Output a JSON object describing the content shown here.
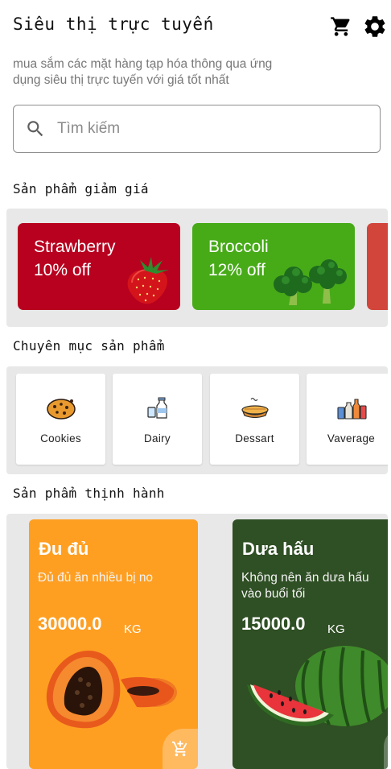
{
  "app": {
    "title": "Siêu thị trực tuyến",
    "subtitle": "mua sắm các mặt hàng tạp hóa thông qua ứng dụng siêu thị trực tuyến với giá tốt nhất",
    "cart_icon": "shopping-cart-icon",
    "settings_icon": "gear-icon"
  },
  "search": {
    "placeholder": "Tìm kiếm",
    "value": "",
    "icon": "search-icon"
  },
  "sections": {
    "discount": "Sản phẩm giảm giá",
    "categories": "Chuyên mục sản phẩm",
    "trending": "Sản phẩm thịnh hành"
  },
  "discount_products": [
    {
      "name": "Strawberry",
      "discount": "10% off",
      "color": "#b8001f"
    },
    {
      "name": "Broccoli",
      "discount": "12% off",
      "color": "#47ab18"
    }
  ],
  "categories": [
    {
      "label": "Cookies",
      "icon": "cookie-icon"
    },
    {
      "label": "Dairy",
      "icon": "milk-bottle-icon"
    },
    {
      "label": "Dessart",
      "icon": "pie-icon"
    },
    {
      "label": "Vaverage",
      "icon": "beverage-bottles-icon"
    }
  ],
  "trending_products": [
    {
      "name": "Đu đủ",
      "description": "Đủ đủ ăn nhiều bị no",
      "price": "30000.0",
      "unit": "KG",
      "color": "#ff9f22"
    },
    {
      "name": "Dưa hấu",
      "description": "Không nên ăn dưa hấu vào buổi tối",
      "price": "15000.0",
      "unit": "KG",
      "color": "#2f4f24"
    }
  ],
  "colors": {
    "strip_background": "#e8e8e8",
    "partial_deal_card": "#d2453b"
  }
}
